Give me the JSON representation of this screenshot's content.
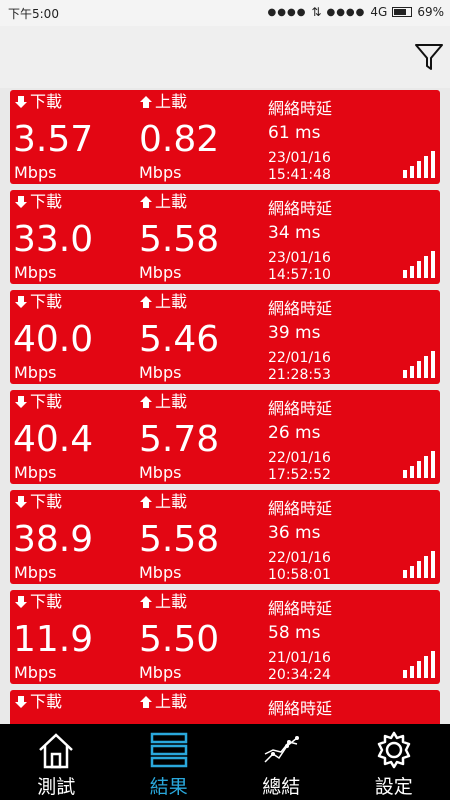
{
  "status": {
    "time": "下午5:00",
    "network": "4G",
    "battery": "69%"
  },
  "toolbar": {
    "filter_icon": "filter-icon"
  },
  "labels": {
    "download": "下載",
    "upload": "上載",
    "latency": "網絡時延",
    "unit": "Mbps"
  },
  "colors": {
    "card": "#e30613",
    "accent": "#2aa8dc",
    "navbar": "#000000"
  },
  "results": [
    {
      "download": "3.57",
      "upload": "0.82",
      "latency": "61 ms",
      "date": "23/01/16",
      "time": "15:41:48"
    },
    {
      "download": "33.0",
      "upload": "5.58",
      "latency": "34 ms",
      "date": "23/01/16",
      "time": "14:57:10"
    },
    {
      "download": "40.0",
      "upload": "5.46",
      "latency": "39 ms",
      "date": "22/01/16",
      "time": "21:28:53"
    },
    {
      "download": "40.4",
      "upload": "5.78",
      "latency": "26 ms",
      "date": "22/01/16",
      "time": "17:52:52"
    },
    {
      "download": "38.9",
      "upload": "5.58",
      "latency": "36 ms",
      "date": "22/01/16",
      "time": "10:58:01"
    },
    {
      "download": "11.9",
      "upload": "5.50",
      "latency": "58 ms",
      "date": "21/01/16",
      "time": "20:34:24"
    },
    {
      "download": "",
      "upload": "",
      "latency": "",
      "date": "",
      "time": ""
    }
  ],
  "nav": [
    {
      "label": "測試",
      "icon": "home-icon"
    },
    {
      "label": "結果",
      "icon": "list-icon",
      "active": true
    },
    {
      "label": "總結",
      "icon": "trend-chart-icon"
    },
    {
      "label": "設定",
      "icon": "gear-icon"
    }
  ]
}
